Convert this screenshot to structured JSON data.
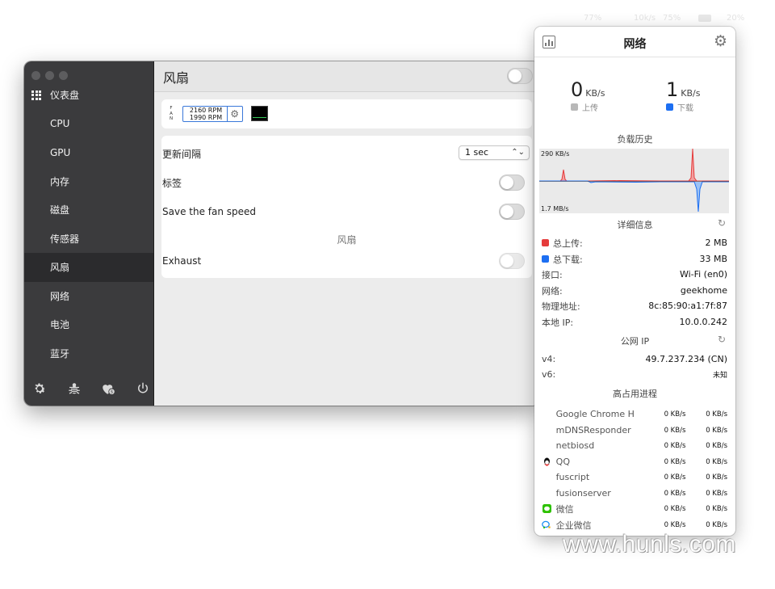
{
  "menubar": [
    "77%",
    "10k/s",
    "75%",
    "",
    "20%"
  ],
  "sidebar": {
    "items": [
      {
        "label": "仪表盘"
      },
      {
        "label": "CPU"
      },
      {
        "label": "GPU"
      },
      {
        "label": "内存"
      },
      {
        "label": "磁盘"
      },
      {
        "label": "传感器"
      },
      {
        "label": "风扇"
      },
      {
        "label": "网络"
      },
      {
        "label": "电池"
      },
      {
        "label": "蓝牙"
      }
    ],
    "active_index": 6,
    "footer_icons": [
      "gear-icon",
      "bug-icon",
      "heart-icon",
      "power-icon"
    ]
  },
  "content": {
    "title": "风扇",
    "fan_widget": {
      "letters": "F A N",
      "rpm_1": "2160 RPM",
      "rpm_2": "1990 RPM"
    },
    "settings": {
      "update_interval_label": "更新间隔",
      "update_interval_value": "1 sec",
      "label_label": "标签",
      "save_speed_label": "Save the fan speed",
      "section_label": "风扇",
      "exhaust_label": "Exhaust"
    }
  },
  "popup": {
    "title": "网络",
    "upload": {
      "value": "0",
      "unit": "KB/s",
      "label": "上传",
      "color": "#b8b8b8"
    },
    "download": {
      "value": "1",
      "unit": "KB/s",
      "label": "下载",
      "color": "#1d6ff2"
    },
    "history_title": "负载历史",
    "graph_top": "290 KB/s",
    "graph_bottom": "1.7 MB/s",
    "details_title": "详细信息",
    "details": [
      {
        "key": "总上传:",
        "value": "2 MB",
        "color": "#e53b3b"
      },
      {
        "key": "总下载:",
        "value": "33 MB",
        "color": "#1d6ff2"
      },
      {
        "key": "接口:",
        "value": "Wi-Fi (en0)"
      },
      {
        "key": "网络:",
        "value": "geekhome"
      },
      {
        "key": "物理地址:",
        "value": "8c:85:90:a1:7f:87"
      },
      {
        "key": "本地 IP:",
        "value": "10.0.0.242"
      }
    ],
    "public_ip_title": "公网 IP",
    "public_ip": [
      {
        "key": "v4:",
        "value": "49.7.237.234 (CN)"
      },
      {
        "key": "v6:",
        "value": "未知"
      }
    ],
    "processes_title": "高占用进程",
    "processes": [
      {
        "name": "Google Chrome H",
        "up": "0 KB/s",
        "down": "0 KB/s",
        "icon": ""
      },
      {
        "name": "mDNSResponder",
        "up": "0 KB/s",
        "down": "0 KB/s",
        "icon": ""
      },
      {
        "name": "netbiosd",
        "up": "0 KB/s",
        "down": "0 KB/s",
        "icon": ""
      },
      {
        "name": "QQ",
        "up": "0 KB/s",
        "down": "0 KB/s",
        "icon": "qq-icon"
      },
      {
        "name": "fuscript",
        "up": "0 KB/s",
        "down": "0 KB/s",
        "icon": ""
      },
      {
        "name": "fusionserver",
        "up": "0 KB/s",
        "down": "0 KB/s",
        "icon": ""
      },
      {
        "name": "微信",
        "up": "0 KB/s",
        "down": "0 KB/s",
        "icon": "wechat-icon"
      },
      {
        "name": "企业微信",
        "up": "0 KB/s",
        "down": "0 KB/s",
        "icon": "wecom-icon"
      }
    ]
  },
  "watermark": "www.hunls.com"
}
